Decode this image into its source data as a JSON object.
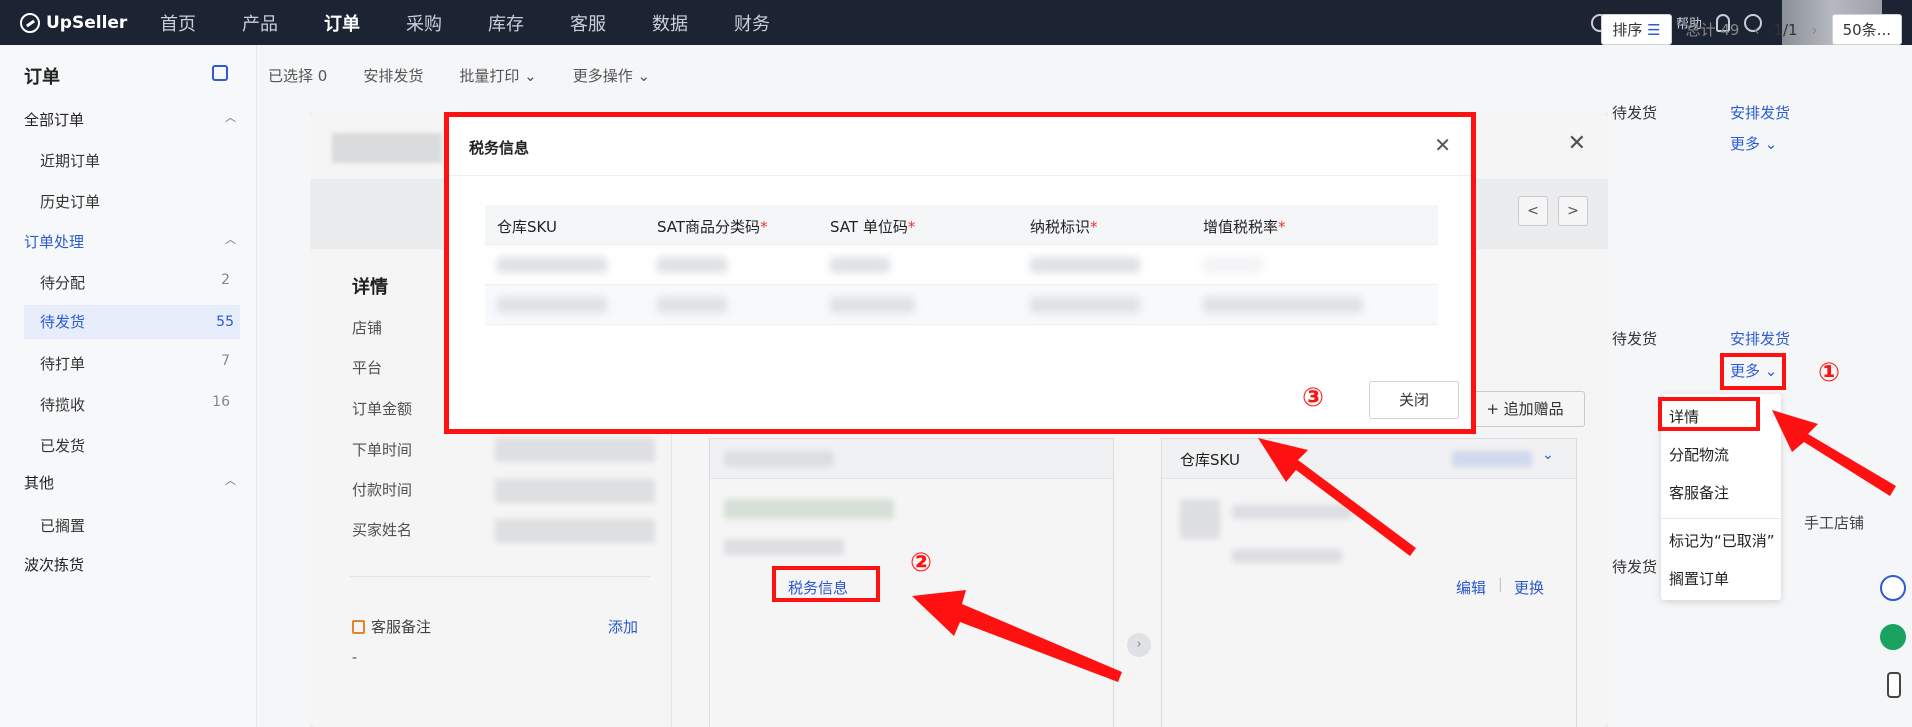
{
  "app": {
    "brand": "UpSeller",
    "nav": [
      "首页",
      "产品",
      "订单",
      "采购",
      "库存",
      "客服",
      "数据",
      "财务"
    ],
    "nav_active_index": 2,
    "help_label": "帮助"
  },
  "sidebar": {
    "title": "订单",
    "groups": [
      {
        "label": "全部订单",
        "items": [
          {
            "label": "近期订单"
          },
          {
            "label": "历史订单"
          }
        ]
      },
      {
        "label": "订单处理",
        "items": [
          {
            "label": "待分配",
            "count": "2"
          },
          {
            "label": "待发货",
            "count": "55"
          },
          {
            "label": "待打单",
            "count": "7"
          },
          {
            "label": "待揽收",
            "count": "16"
          },
          {
            "label": "已发货",
            "count": ""
          }
        ]
      },
      {
        "label": "其他",
        "items": [
          {
            "label": "已搁置"
          }
        ]
      },
      {
        "label": "波次拣货",
        "items": []
      }
    ]
  },
  "toolbar": {
    "selected": "已选择 0",
    "arrange": "安排发货",
    "batch_print": "批量打印",
    "more_ops": "更多操作",
    "sort": "排序",
    "total": "总计 49",
    "page": "1/1",
    "page_size": "50条..."
  },
  "list_bg": {
    "status_1": "待发货",
    "arrange_1": "安排发货",
    "more_1": "更多",
    "status_2": "待发货",
    "arrange_2": "安排发货",
    "more_2": "更多",
    "status_3": "待发货",
    "arrange_3": "货",
    "manual_shop": "手工店铺"
  },
  "dropdown": {
    "items": [
      "详情",
      "分配物流",
      "客服备注",
      "标记为“已取消”",
      "搁置订单"
    ]
  },
  "detail_modal": {
    "title": "详情",
    "labels": [
      "店铺",
      "平台",
      "订单金额",
      "下单时间",
      "付款时间",
      "买家姓名"
    ],
    "note_label": "客服备注",
    "add": "添加",
    "dash": "-",
    "add_gift": "追加赠品",
    "warehouse_sku": "仓库SKU",
    "tax_info_link": "税务信息",
    "edit": "编辑",
    "replace": "更换",
    "prev": "<",
    "next": ">"
  },
  "tax_modal": {
    "title": "税务信息",
    "columns": [
      "仓库SKU",
      "SAT商品分类码",
      "SAT 单位码",
      "纳税标识",
      "增值税税率"
    ],
    "required": [
      false,
      true,
      true,
      true,
      true
    ],
    "close_button": "关闭"
  },
  "annotations": {
    "marker_1": "①",
    "marker_2": "②",
    "marker_3": "③"
  },
  "colors": {
    "accent": "#2d5bd8",
    "annotation": "#ff1111",
    "nav_bg": "#1c2433"
  }
}
